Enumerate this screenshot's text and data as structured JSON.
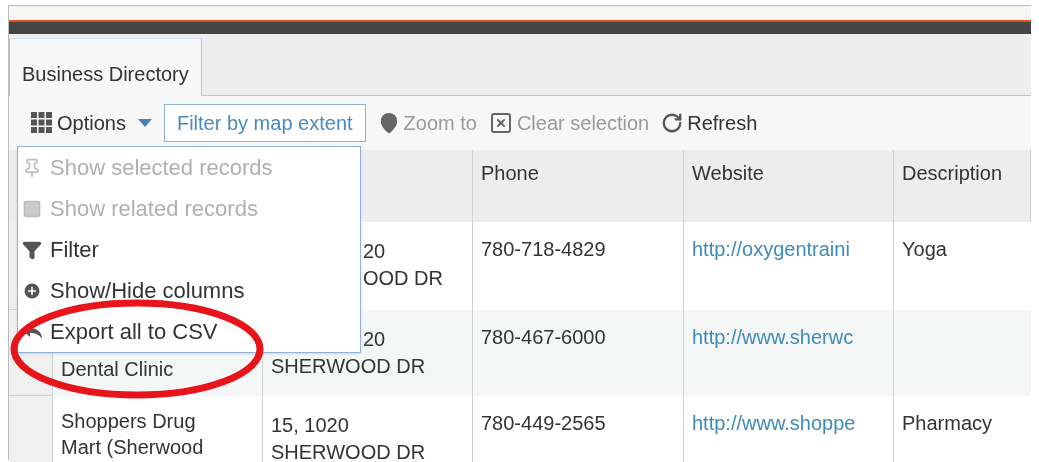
{
  "tabs": [
    {
      "label": "Business Directory",
      "selected": true
    }
  ],
  "toolbar": {
    "options": {
      "label": "Options",
      "expanded": true
    },
    "buttons": [
      {
        "label": "Filter by map extent",
        "kind": "toggle",
        "disabled": false
      },
      {
        "label": "Zoom to",
        "kind": "zoom",
        "disabled": true
      },
      {
        "label": "Clear selection",
        "kind": "clear",
        "disabled": true
      },
      {
        "label": "Refresh",
        "kind": "refresh",
        "disabled": false
      }
    ]
  },
  "options_menu": [
    {
      "label": "Show selected records",
      "kind": "pin",
      "disabled": true
    },
    {
      "label": "Show related records",
      "kind": "related",
      "disabled": true
    },
    {
      "label": "Filter",
      "kind": "filter",
      "disabled": false
    },
    {
      "label": "Show/Hide columns",
      "kind": "columns",
      "disabled": false
    },
    {
      "label": "Export all to CSV",
      "kind": "export",
      "disabled": false,
      "circled": true
    }
  ],
  "table": {
    "columns": [
      "Phone",
      "Website",
      "Description"
    ],
    "rows": [
      {
        "name": [],
        "address": [
          {
            "text": "20",
            "covered": true
          },
          {
            "text": "OOD DR",
            "covered": true
          }
        ],
        "phone": "780-718-4829",
        "website": "http://oxygentraini",
        "description": "Yoga"
      },
      {
        "name": [
          {
            "text": "Dental Clinic",
            "covered": false,
            "after_gap": true
          }
        ],
        "address": [
          {
            "text": "20",
            "covered": true
          },
          {
            "text": "SHERWOOD DR",
            "covered": false
          }
        ],
        "phone": "780-467-6000",
        "website": "http://www.sherwc",
        "description": ""
      },
      {
        "name": [
          {
            "text": "Shoppers Drug",
            "covered": false
          },
          {
            "text": "Mart (Sherwood",
            "covered": false
          }
        ],
        "address": [
          {
            "text": "15, 1020",
            "covered": false
          },
          {
            "text": "SHERWOOD DR",
            "covered": false
          }
        ],
        "phone": "780-449-2565",
        "website": "http://www.shoppe",
        "description": "Pharmacy"
      }
    ]
  }
}
